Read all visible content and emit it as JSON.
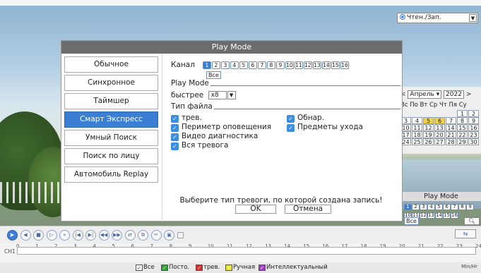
{
  "dialog": {
    "title": "Play Mode",
    "modes": [
      {
        "label": "Обычное",
        "active": false
      },
      {
        "label": "Синхронное",
        "active": false
      },
      {
        "label": "Таймшер",
        "active": false
      },
      {
        "label": "Смарт Экспресс",
        "active": true
      },
      {
        "label": "Умный Поиск",
        "active": false
      },
      {
        "label": "Поиск по лицу",
        "active": false
      },
      {
        "label": "Автомобиль Replay",
        "active": false
      }
    ],
    "channel_label": "Канал",
    "channels": [
      "1",
      "2",
      "3",
      "4",
      "5",
      "6",
      "7",
      "8",
      "9",
      "10",
      "11",
      "12",
      "13",
      "14",
      "15",
      "16"
    ],
    "selected_channel": "1",
    "all_label": "Все",
    "play_mode_section": "Play Mode",
    "speed_label": "быстрее",
    "speed_value": "x8",
    "file_type_section": "Тип файла",
    "checkboxes_left": [
      "трев.",
      "Периметр оповещения",
      "Видео диагностика",
      "Вся тревога"
    ],
    "checkboxes_right": [
      "Обнар.",
      "Предметы ухода"
    ],
    "hint": "Выберите тип тревоги, по которой создана запись!",
    "ok_label": "OK",
    "cancel_label": "Отмена"
  },
  "right_panel": {
    "mode_select": "Чтен./Зап.",
    "calendar": {
      "left_arrow": "<",
      "month": "Апрель",
      "year": "2022",
      "right_arrow": ">",
      "weekdays": "Вс По Вт Ср Чт Пя Су",
      "rows": [
        [
          "",
          "",
          "",
          "",
          "",
          "1",
          "2"
        ],
        [
          "3",
          "4",
          "5",
          "6",
          "7",
          "8",
          "9"
        ],
        [
          "10",
          "11",
          "12",
          "13",
          "14",
          "15",
          "16"
        ],
        [
          "17",
          "18",
          "19",
          "20",
          "21",
          "22",
          "23"
        ],
        [
          "24",
          "25",
          "26",
          "27",
          "28",
          "29",
          "30"
        ]
      ],
      "highlighted": [
        "5",
        "6"
      ]
    },
    "play_mode_label": "Play Mode",
    "pm_channels": [
      "1",
      "2",
      "3",
      "4",
      "5",
      "6",
      "7",
      "8",
      "9",
      "10",
      "11",
      "12",
      "13",
      "14",
      "15",
      "16"
    ],
    "pm_all": "Все",
    "search_icon": "search-icon"
  },
  "controls": {
    "buttons": [
      "play-icon",
      "rewind-icon",
      "stop-icon",
      "slow-icon",
      "fast-icon",
      "prev-frame-icon",
      "next-frame-icon",
      "prev-file-icon",
      "next-file-icon",
      "sync-icon",
      "backup-icon",
      "cut-icon",
      "save-icon",
      "square-icon"
    ],
    "zoom_label": "⇆"
  },
  "timeline": {
    "channel": "CH1",
    "hours": [
      "0",
      "1",
      "2",
      "3",
      "4",
      "5",
      "6",
      "7",
      "8",
      "9",
      "10",
      "11",
      "12",
      "13",
      "14",
      "15",
      "16",
      "17",
      "18",
      "19",
      "20",
      "21",
      "22",
      "23",
      "24"
    ],
    "legend": [
      {
        "label": "Все",
        "color": "#ffffff"
      },
      {
        "label": "Посто.",
        "color": "#2e9e34"
      },
      {
        "label": "трев.",
        "color": "#d92b2b"
      },
      {
        "label": "Ручная",
        "color": "#e6e62e"
      },
      {
        "label": "Интеллектуальный",
        "color": "#9b3fbf"
      }
    ],
    "unit": "Min/Hr"
  }
}
